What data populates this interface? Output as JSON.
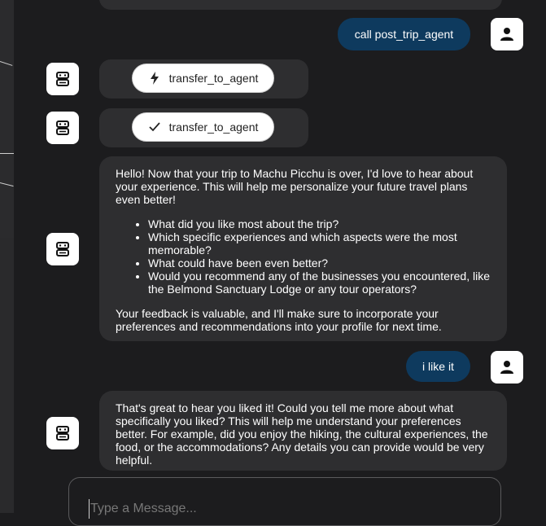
{
  "messages": {
    "user_1": "call post_trip_agent",
    "tool_call_1": {
      "icon": "lightning-icon",
      "label": "transfer_to_agent"
    },
    "tool_result_1": {
      "icon": "check-icon",
      "label": "transfer_to_agent"
    },
    "agent_1": {
      "intro": "Hello! Now that your trip to Machu Picchu is over, I'd love to hear about your experience. This will help me personalize your future travel plans even better!",
      "bullets": [
        "What did you like most about the trip?",
        "Which specific experiences and which aspects were the most memorable?",
        "What could have been even better?",
        "Would you recommend any of the businesses you encountered, like the Belmond Sanctuary Lodge or any tour operators?"
      ],
      "outro": "Your feedback is valuable, and I'll make sure to incorporate your preferences and recommendations into your profile for next time."
    },
    "user_2": "i like it",
    "agent_2": "That's great to hear you liked it! Could you tell me more about what specifically you liked? This will help me understand your preferences better. For example, did you enjoy the hiking, the cultural experiences, the food, or the accommodations? Any details you can provide would be very helpful."
  },
  "composer": {
    "placeholder": "Type a Message...",
    "value": ""
  },
  "icons": {
    "user_avatar": "user-icon",
    "agent_avatar": "robot-icon"
  },
  "colors": {
    "background": "#1c1c1e",
    "bubble": "#2e2e30",
    "user_pill": "#0e3a5e"
  }
}
